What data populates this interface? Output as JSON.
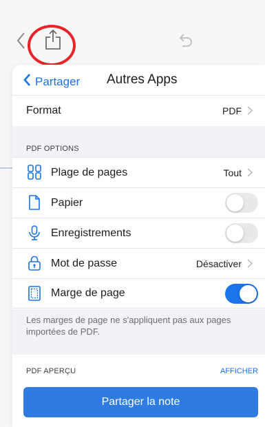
{
  "toolbar": {
    "back_icon": "chevron-left-icon",
    "share_icon": "share-icon",
    "undo_icon": "undo-icon",
    "highlight_color": "#e8232a"
  },
  "nav": {
    "back_label": "Partager",
    "title": "Autres Apps",
    "accent": "#1a73e8"
  },
  "format_row": {
    "label": "Format",
    "value": "PDF"
  },
  "pdf_options": {
    "header": "PDF OPTIONS",
    "rows": [
      {
        "label": "Plage de pages",
        "value": "Tout",
        "icon": "page-grid-icon"
      },
      {
        "label": "Papier",
        "icon": "paper-icon",
        "toggle": false
      },
      {
        "label": "Enregistrements",
        "icon": "microphone-icon",
        "toggle": false
      },
      {
        "label": "Mot de passe",
        "value": "Désactiver",
        "icon": "lock-icon"
      },
      {
        "label": "Marge de page",
        "icon": "page-margin-icon",
        "toggle": true
      }
    ]
  },
  "footnote": "Les marges de page ne s'appliquent pas aux pages importées de PDF.",
  "pdf_preview": {
    "header": "PDF APERÇU",
    "action": "AFFICHER"
  },
  "share_button": {
    "label": "Partager la note",
    "color": "#2f7be0"
  }
}
